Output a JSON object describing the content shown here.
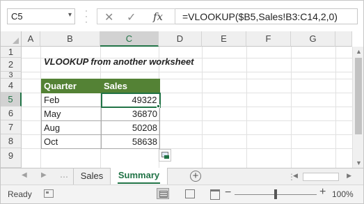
{
  "namebox": {
    "value": "C5"
  },
  "formula_bar": {
    "cancel_icon": "✕",
    "enter_icon": "✓",
    "fx_label": "fx",
    "formula": "=VLOOKUP($B5,Sales!B3:C14,2,0)"
  },
  "columns": [
    "A",
    "B",
    "C",
    "D",
    "E",
    "F",
    "G"
  ],
  "rows": [
    "1",
    "2",
    "3",
    "4",
    "5",
    "6",
    "7",
    "8",
    "9"
  ],
  "title": "VLOOKUP from another worksheet",
  "table": {
    "headers": [
      "Quarter",
      "Sales"
    ],
    "rows": [
      {
        "quarter": "Feb",
        "sales": "49322"
      },
      {
        "quarter": "May",
        "sales": "36870"
      },
      {
        "quarter": "Aug",
        "sales": "50208"
      },
      {
        "quarter": "Oct",
        "sales": "58638"
      }
    ]
  },
  "tabs": {
    "sales": "Sales",
    "summary": "Summary",
    "add": "+"
  },
  "status": {
    "ready": "Ready",
    "zoom": "100%",
    "zoom_minus": "−",
    "zoom_plus": "+"
  },
  "colors": {
    "accent": "#217346",
    "table_header": "#548235"
  }
}
